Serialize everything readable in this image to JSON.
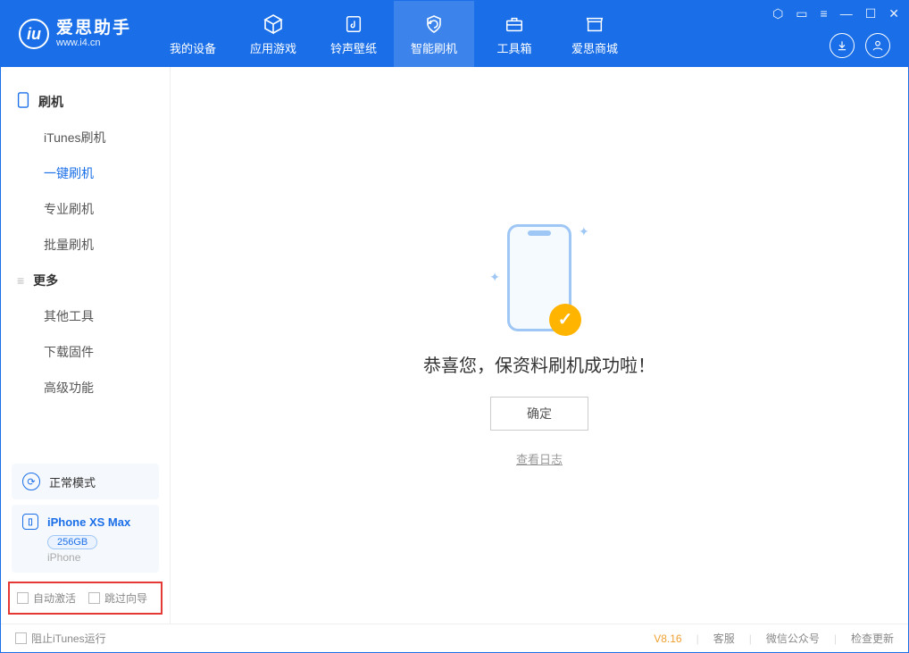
{
  "app": {
    "name": "爱思助手",
    "url": "www.i4.cn"
  },
  "nav": {
    "tabs": [
      {
        "label": "我的设备"
      },
      {
        "label": "应用游戏"
      },
      {
        "label": "铃声壁纸"
      },
      {
        "label": "智能刷机"
      },
      {
        "label": "工具箱"
      },
      {
        "label": "爱思商城"
      }
    ]
  },
  "sidebar": {
    "section1_title": "刷机",
    "items1": [
      {
        "label": "iTunes刷机"
      },
      {
        "label": "一键刷机"
      },
      {
        "label": "专业刷机"
      },
      {
        "label": "批量刷机"
      }
    ],
    "section2_title": "更多",
    "items2": [
      {
        "label": "其他工具"
      },
      {
        "label": "下载固件"
      },
      {
        "label": "高级功能"
      }
    ],
    "mode_label": "正常模式",
    "device_name": "iPhone XS Max",
    "device_capacity": "256GB",
    "device_type": "iPhone",
    "cb_auto_activate": "自动激活",
    "cb_skip_guide": "跳过向导"
  },
  "main": {
    "success_message": "恭喜您，保资料刷机成功啦！",
    "ok_button": "确定",
    "view_log": "查看日志"
  },
  "statusbar": {
    "stop_itunes": "阻止iTunes运行",
    "version": "V8.16",
    "customer_service": "客服",
    "wechat": "微信公众号",
    "check_update": "检查更新"
  }
}
